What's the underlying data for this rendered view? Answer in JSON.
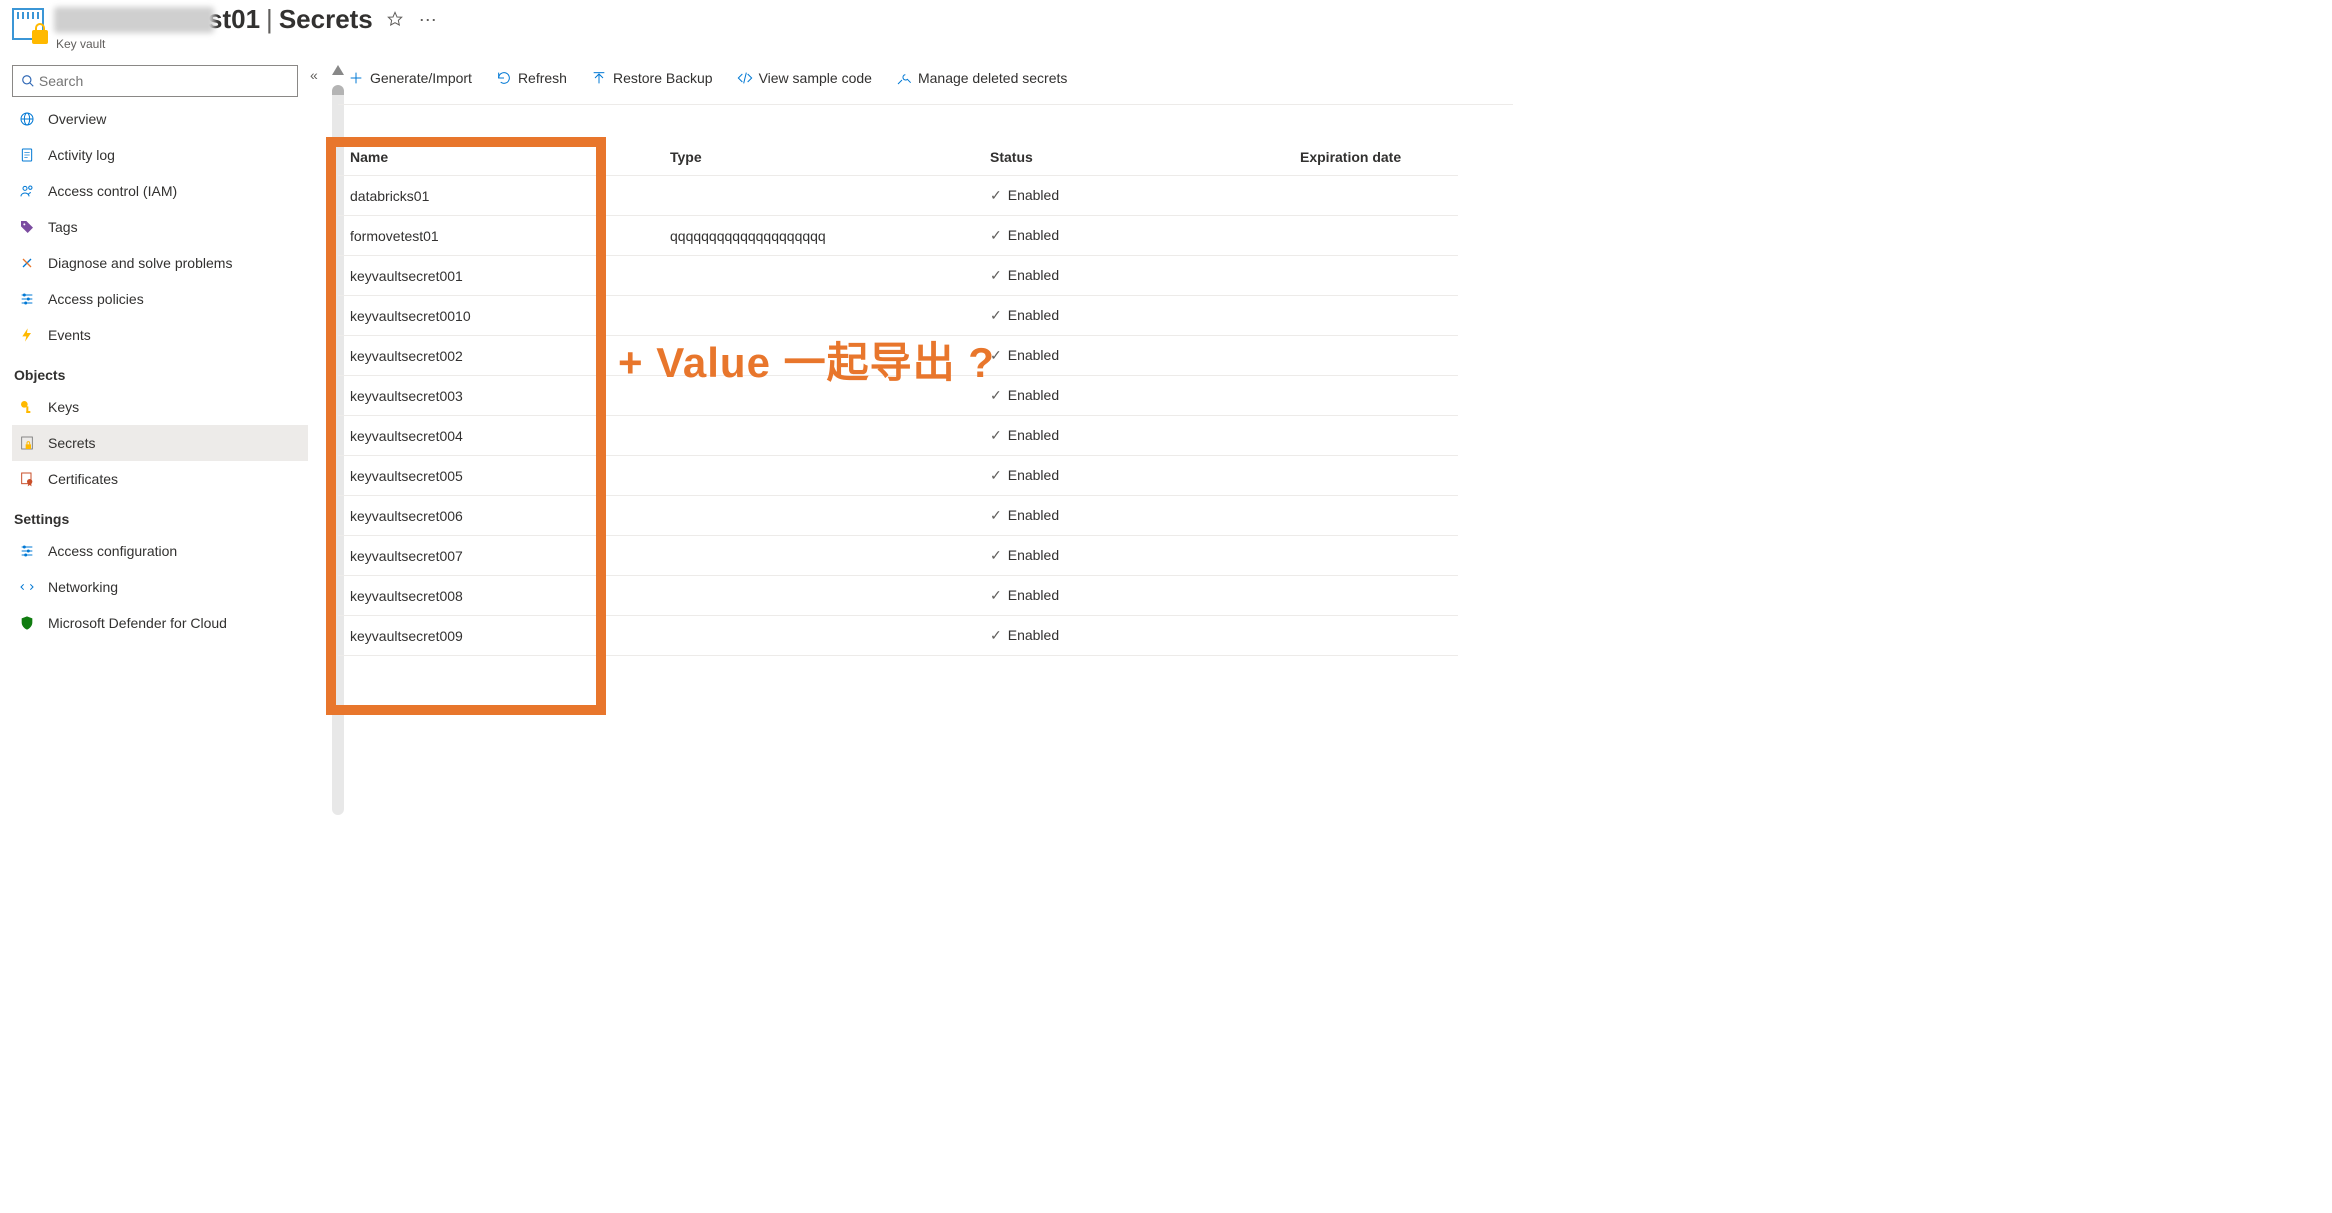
{
  "header": {
    "title_obscured_suffix": "st01",
    "title_section": "Secrets",
    "subtitle": "Key vault"
  },
  "search": {
    "placeholder": "Search"
  },
  "sidebar": {
    "items": [
      {
        "label": "Overview",
        "icon": "globe"
      },
      {
        "label": "Activity log",
        "icon": "log"
      },
      {
        "label": "Access control (IAM)",
        "icon": "iam"
      },
      {
        "label": "Tags",
        "icon": "tag"
      },
      {
        "label": "Diagnose and solve problems",
        "icon": "diagnose"
      },
      {
        "label": "Access policies",
        "icon": "policies"
      },
      {
        "label": "Events",
        "icon": "events"
      }
    ],
    "section_objects": "Objects",
    "objects": [
      {
        "label": "Keys",
        "icon": "key"
      },
      {
        "label": "Secrets",
        "icon": "secret",
        "active": true
      },
      {
        "label": "Certificates",
        "icon": "cert"
      }
    ],
    "section_settings": "Settings",
    "settings": [
      {
        "label": "Access configuration",
        "icon": "policies"
      },
      {
        "label": "Networking",
        "icon": "net"
      },
      {
        "label": "Microsoft Defender for Cloud",
        "icon": "defender"
      }
    ]
  },
  "toolbar": {
    "generate": "Generate/Import",
    "refresh": "Refresh",
    "restore": "Restore Backup",
    "view_code": "View sample code",
    "manage_deleted": "Manage deleted secrets"
  },
  "table": {
    "headers": {
      "name": "Name",
      "type": "Type",
      "status": "Status",
      "expiration": "Expiration date"
    },
    "status_enabled": "Enabled",
    "rows": [
      {
        "name": "databricks01",
        "type": "",
        "status": "Enabled",
        "expiration": ""
      },
      {
        "name": "formovetest01",
        "type": "qqqqqqqqqqqqqqqqqqqq",
        "status": "Enabled",
        "expiration": ""
      },
      {
        "name": "keyvaultsecret001",
        "type": "",
        "status": "Enabled",
        "expiration": ""
      },
      {
        "name": "keyvaultsecret0010",
        "type": "",
        "status": "Enabled",
        "expiration": ""
      },
      {
        "name": "keyvaultsecret002",
        "type": "",
        "status": "Enabled",
        "expiration": ""
      },
      {
        "name": "keyvaultsecret003",
        "type": "",
        "status": "Enabled",
        "expiration": ""
      },
      {
        "name": "keyvaultsecret004",
        "type": "",
        "status": "Enabled",
        "expiration": ""
      },
      {
        "name": "keyvaultsecret005",
        "type": "",
        "status": "Enabled",
        "expiration": ""
      },
      {
        "name": "keyvaultsecret006",
        "type": "",
        "status": "Enabled",
        "expiration": ""
      },
      {
        "name": "keyvaultsecret007",
        "type": "",
        "status": "Enabled",
        "expiration": ""
      },
      {
        "name": "keyvaultsecret008",
        "type": "",
        "status": "Enabled",
        "expiration": ""
      },
      {
        "name": "keyvaultsecret009",
        "type": "",
        "status": "Enabled",
        "expiration": ""
      }
    ]
  },
  "annotation": "+ Value 一起导出 ?"
}
